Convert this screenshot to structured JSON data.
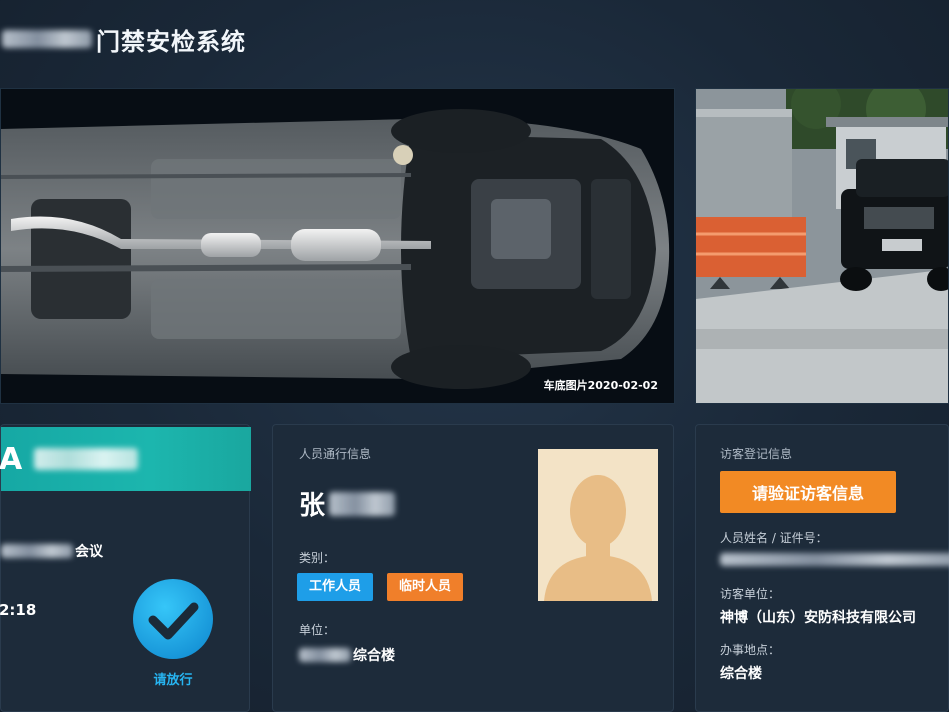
{
  "header": {
    "title": "门禁安检系统"
  },
  "vehicle_image": {
    "caption": "车底图片2020-02-02"
  },
  "pass_card": {
    "plate_prefix": "A",
    "event_suffix": "会议",
    "time_text": "2:18",
    "pass_label": "请放行"
  },
  "person_card": {
    "section_title": "人员通行信息",
    "surname": "张",
    "category_label": "类别：",
    "tags": [
      "工作人员",
      "临时人员"
    ],
    "unit_label": "单位：",
    "unit_suffix": "综合楼"
  },
  "visitor_card": {
    "section_title": "访客登记信息",
    "verify_button": "请验证访客信息",
    "name_id_label": "人员姓名 / 证件号：",
    "company_label": "访客单位：",
    "company_value": "神博（山东）安防科技有限公司",
    "location_label": "办事地点：",
    "location_value": "综合楼"
  },
  "colors": {
    "accent_teal": "#1aa79f",
    "tag_blue": "#1e9ee8",
    "tag_orange": "#f07f2a",
    "button_orange": "#f28a24",
    "check_blue": "#27b4f0"
  }
}
